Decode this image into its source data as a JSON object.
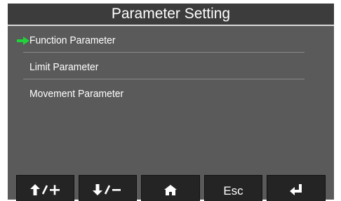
{
  "title": "Parameter Setting",
  "menu": {
    "items": [
      {
        "label": "Function Parameter",
        "selected": true
      },
      {
        "label": "Limit Parameter",
        "selected": false
      },
      {
        "label": "Movement Parameter",
        "selected": false
      }
    ]
  },
  "softkeys": {
    "up_plus": {
      "icon": "arrow-up-plus-icon"
    },
    "down_minus": {
      "icon": "arrow-down-minus-icon"
    },
    "home": {
      "icon": "home-icon"
    },
    "esc": {
      "label": "Esc"
    },
    "enter": {
      "icon": "enter-return-icon"
    }
  },
  "colors": {
    "screen_bg": "#5a5a5a",
    "titlebar_bg": "#3c3c3c",
    "key_bg": "#242424",
    "pointer": "#22d23a",
    "text": "#ffffff"
  }
}
